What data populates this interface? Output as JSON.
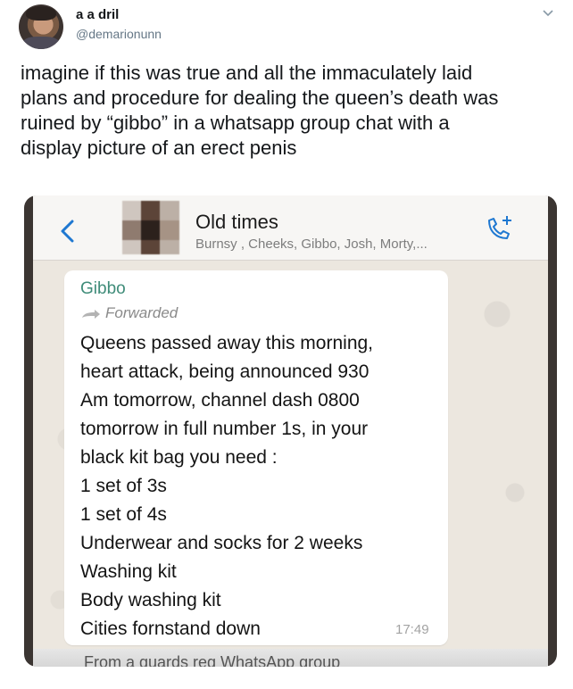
{
  "tweet": {
    "display_name": "a a dril",
    "handle": "@demarionunn",
    "text": "imagine if this was true and all the immaculately laid\nplans and procedure for dealing the queen’s death was\nruined by “gibbo” in a whatsapp group chat with a\ndisplay picture of an erect penis"
  },
  "whatsapp": {
    "group_title": "Old times",
    "members": "Burnsy , Cheeks, Gibbo, Josh, Morty,...",
    "message": {
      "sender": "Gibbo",
      "forwarded_label": "Forwarded",
      "lines": [
        "Queens passed away this morning,",
        "heart attack, being announced 930",
        "Am tomorrow, channel dash 0800",
        "tomorrow in full number 1s, in your",
        "black kit bag you need :",
        "1 set of 3s",
        "1 set of 4s",
        "Underwear and socks for 2 weeks",
        "Washing kit",
        "Body washing kit",
        "Cities fornstand down"
      ],
      "time": "17:49"
    },
    "caption": "From a guards reg WhatsApp group"
  },
  "colors": {
    "sender": "#3f8c79",
    "accent_blue": "#1f78d1"
  },
  "icons": [
    "avatar",
    "caret-down-icon",
    "back-chevron-icon",
    "add-call-icon",
    "forward-arrow-icon"
  ]
}
